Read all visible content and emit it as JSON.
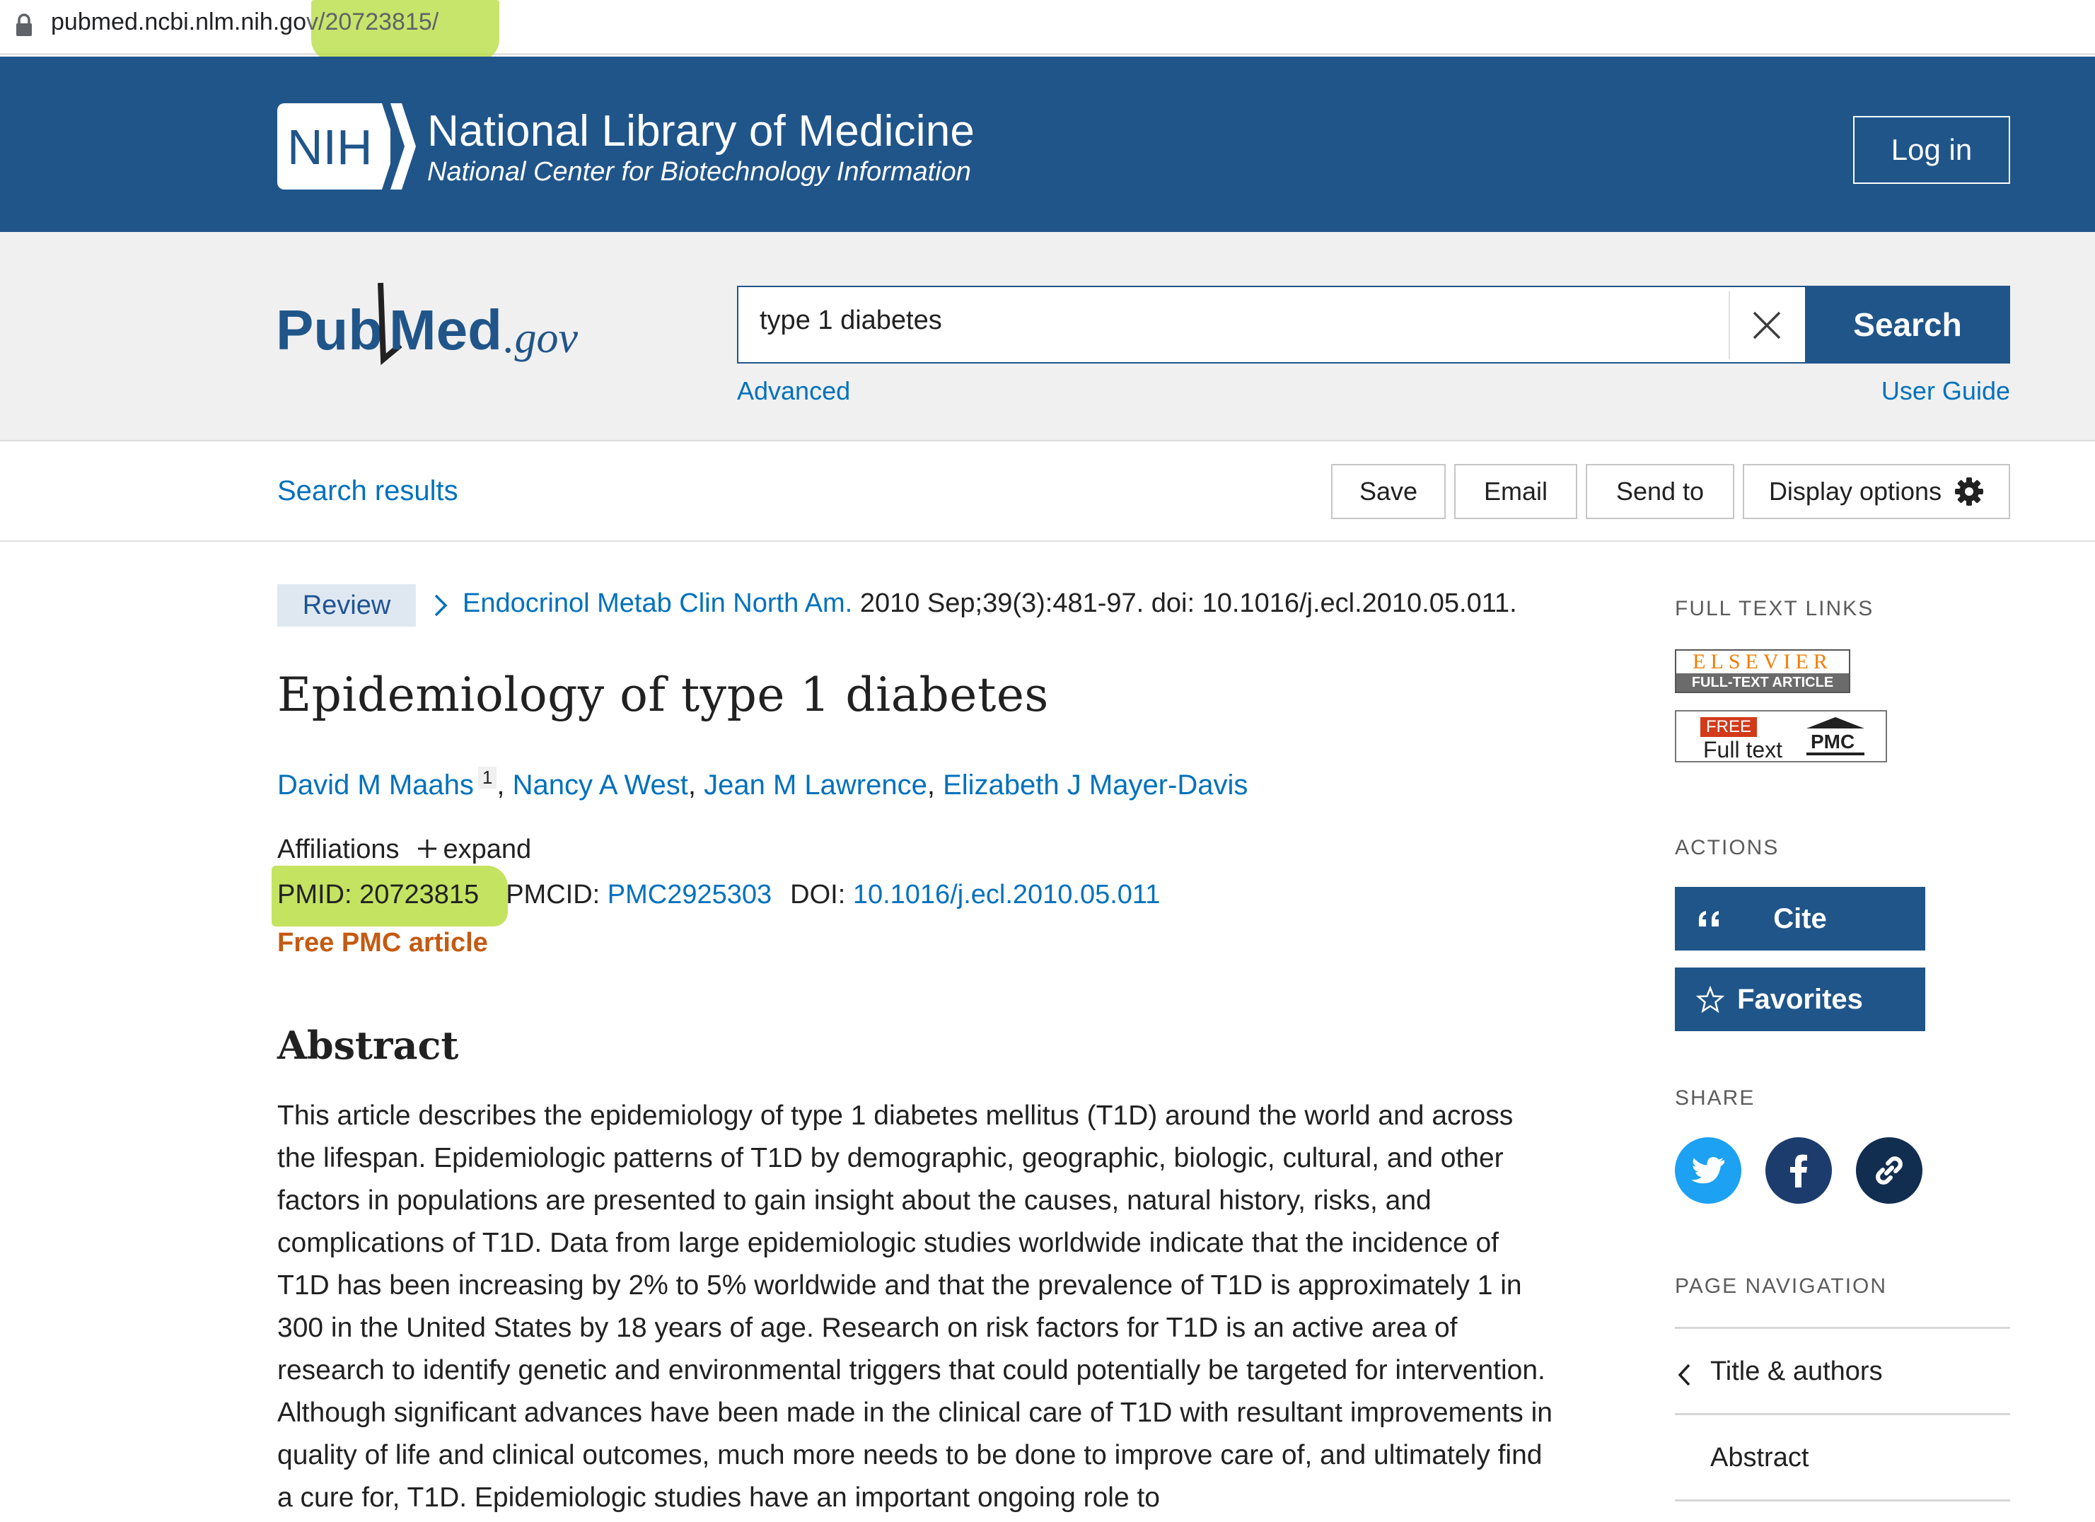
{
  "browser": {
    "url_base": "pubmed.ncbi.nlm.nih.go",
    "url_path": "v/20723815/"
  },
  "nih_header": {
    "logo_text": "NIH",
    "title": "National Library of Medicine",
    "subtitle": "National Center for Biotechnology Information",
    "login_label": "Log in"
  },
  "search": {
    "logo_pub": "Pub",
    "logo_med": "Med",
    "logo_gov": ".gov",
    "query": "type 1 diabetes",
    "search_label": "Search",
    "advanced_label": "Advanced",
    "user_guide_label": "User Guide"
  },
  "toolbar": {
    "search_results_label": "Search results",
    "save_label": "Save",
    "email_label": "Email",
    "send_to_label": "Send to",
    "display_options_label": "Display options"
  },
  "article": {
    "type_tag": "Review",
    "journal": "Endocrinol Metab Clin North Am.",
    "citation": "2010 Sep;39(3):481-97. doi: 10.1016/j.ecl.2010.05.011.",
    "title": "Epidemiology of type 1 diabetes",
    "authors": [
      {
        "name": "David M Maahs",
        "aff": "1"
      },
      {
        "name": "Nancy A West"
      },
      {
        "name": "Jean M Lawrence"
      },
      {
        "name": "Elizabeth J Mayer-Davis"
      }
    ],
    "author_separator": ",",
    "affiliations_label": "Affiliations",
    "expand_label": "expand",
    "pmid_label": "PMID: 20723815",
    "pmcid_label": "PMCID:",
    "pmcid_value": "PMC2925303",
    "doi_label": "DOI:",
    "doi_value": "10.1016/j.ecl.2010.05.011",
    "free_pmc_label": "Free PMC article",
    "abstract_heading": "Abstract",
    "abstract_text": "This article describes the epidemiology of type 1 diabetes mellitus (T1D) around the world and across the lifespan. Epidemiologic patterns of T1D by demographic, geographic, biologic, cultural, and other factors in populations are presented to gain insight about the causes, natural history, risks, and complications of T1D. Data from large epidemiologic studies worldwide indicate that the incidence of T1D has been increasing by 2% to 5% worldwide and that the prevalence of T1D is approximately 1 in 300 in the United States by 18 years of age. Research on risk factors for T1D is an active area of research to identify genetic and environmental triggers that could potentially be targeted for intervention. Although significant advances have been made in the clinical care of T1D with resultant improvements in quality of life and clinical outcomes, much more needs to be done to improve care of, and ultimately find a cure for, T1D. Epidemiologic studies have an important ongoing role to"
  },
  "sidebar": {
    "full_text_heading": "FULL TEXT LINKS",
    "elsevier_top": "ELSEVIER",
    "elsevier_bottom": "FULL-TEXT ARTICLE",
    "pmc_free": "FREE",
    "pmc_fulltext": "Full text",
    "pmc_logo": "PMC",
    "actions_heading": "ACTIONS",
    "cite_label": "Cite",
    "favorites_label": "Favorites",
    "share_heading": "SHARE",
    "page_nav_heading": "PAGE NAVIGATION",
    "nav_items": [
      "Title & authors",
      "Abstract"
    ]
  },
  "colors": {
    "nih_blue": "#20558a",
    "link_blue": "#0071bc",
    "highlight": "#b5dc3a",
    "free_pmc": "#c55a11",
    "twitter": "#1da1f2",
    "facebook": "#1d3c6e",
    "permalink": "#112e51"
  }
}
